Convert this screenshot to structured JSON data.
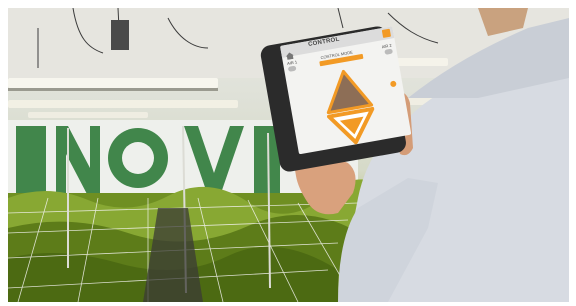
{
  "tablet": {
    "title": "CONTROL",
    "left_label": "AIR 1",
    "right_label": "AIR 2",
    "top_label": "CONTROL MODE"
  },
  "colors": {
    "accent_orange": "#f29a25",
    "arrow_up_fill": "#8d6e56",
    "plant_green": "#6f8f22",
    "sign_green": "#2f7b3a"
  }
}
